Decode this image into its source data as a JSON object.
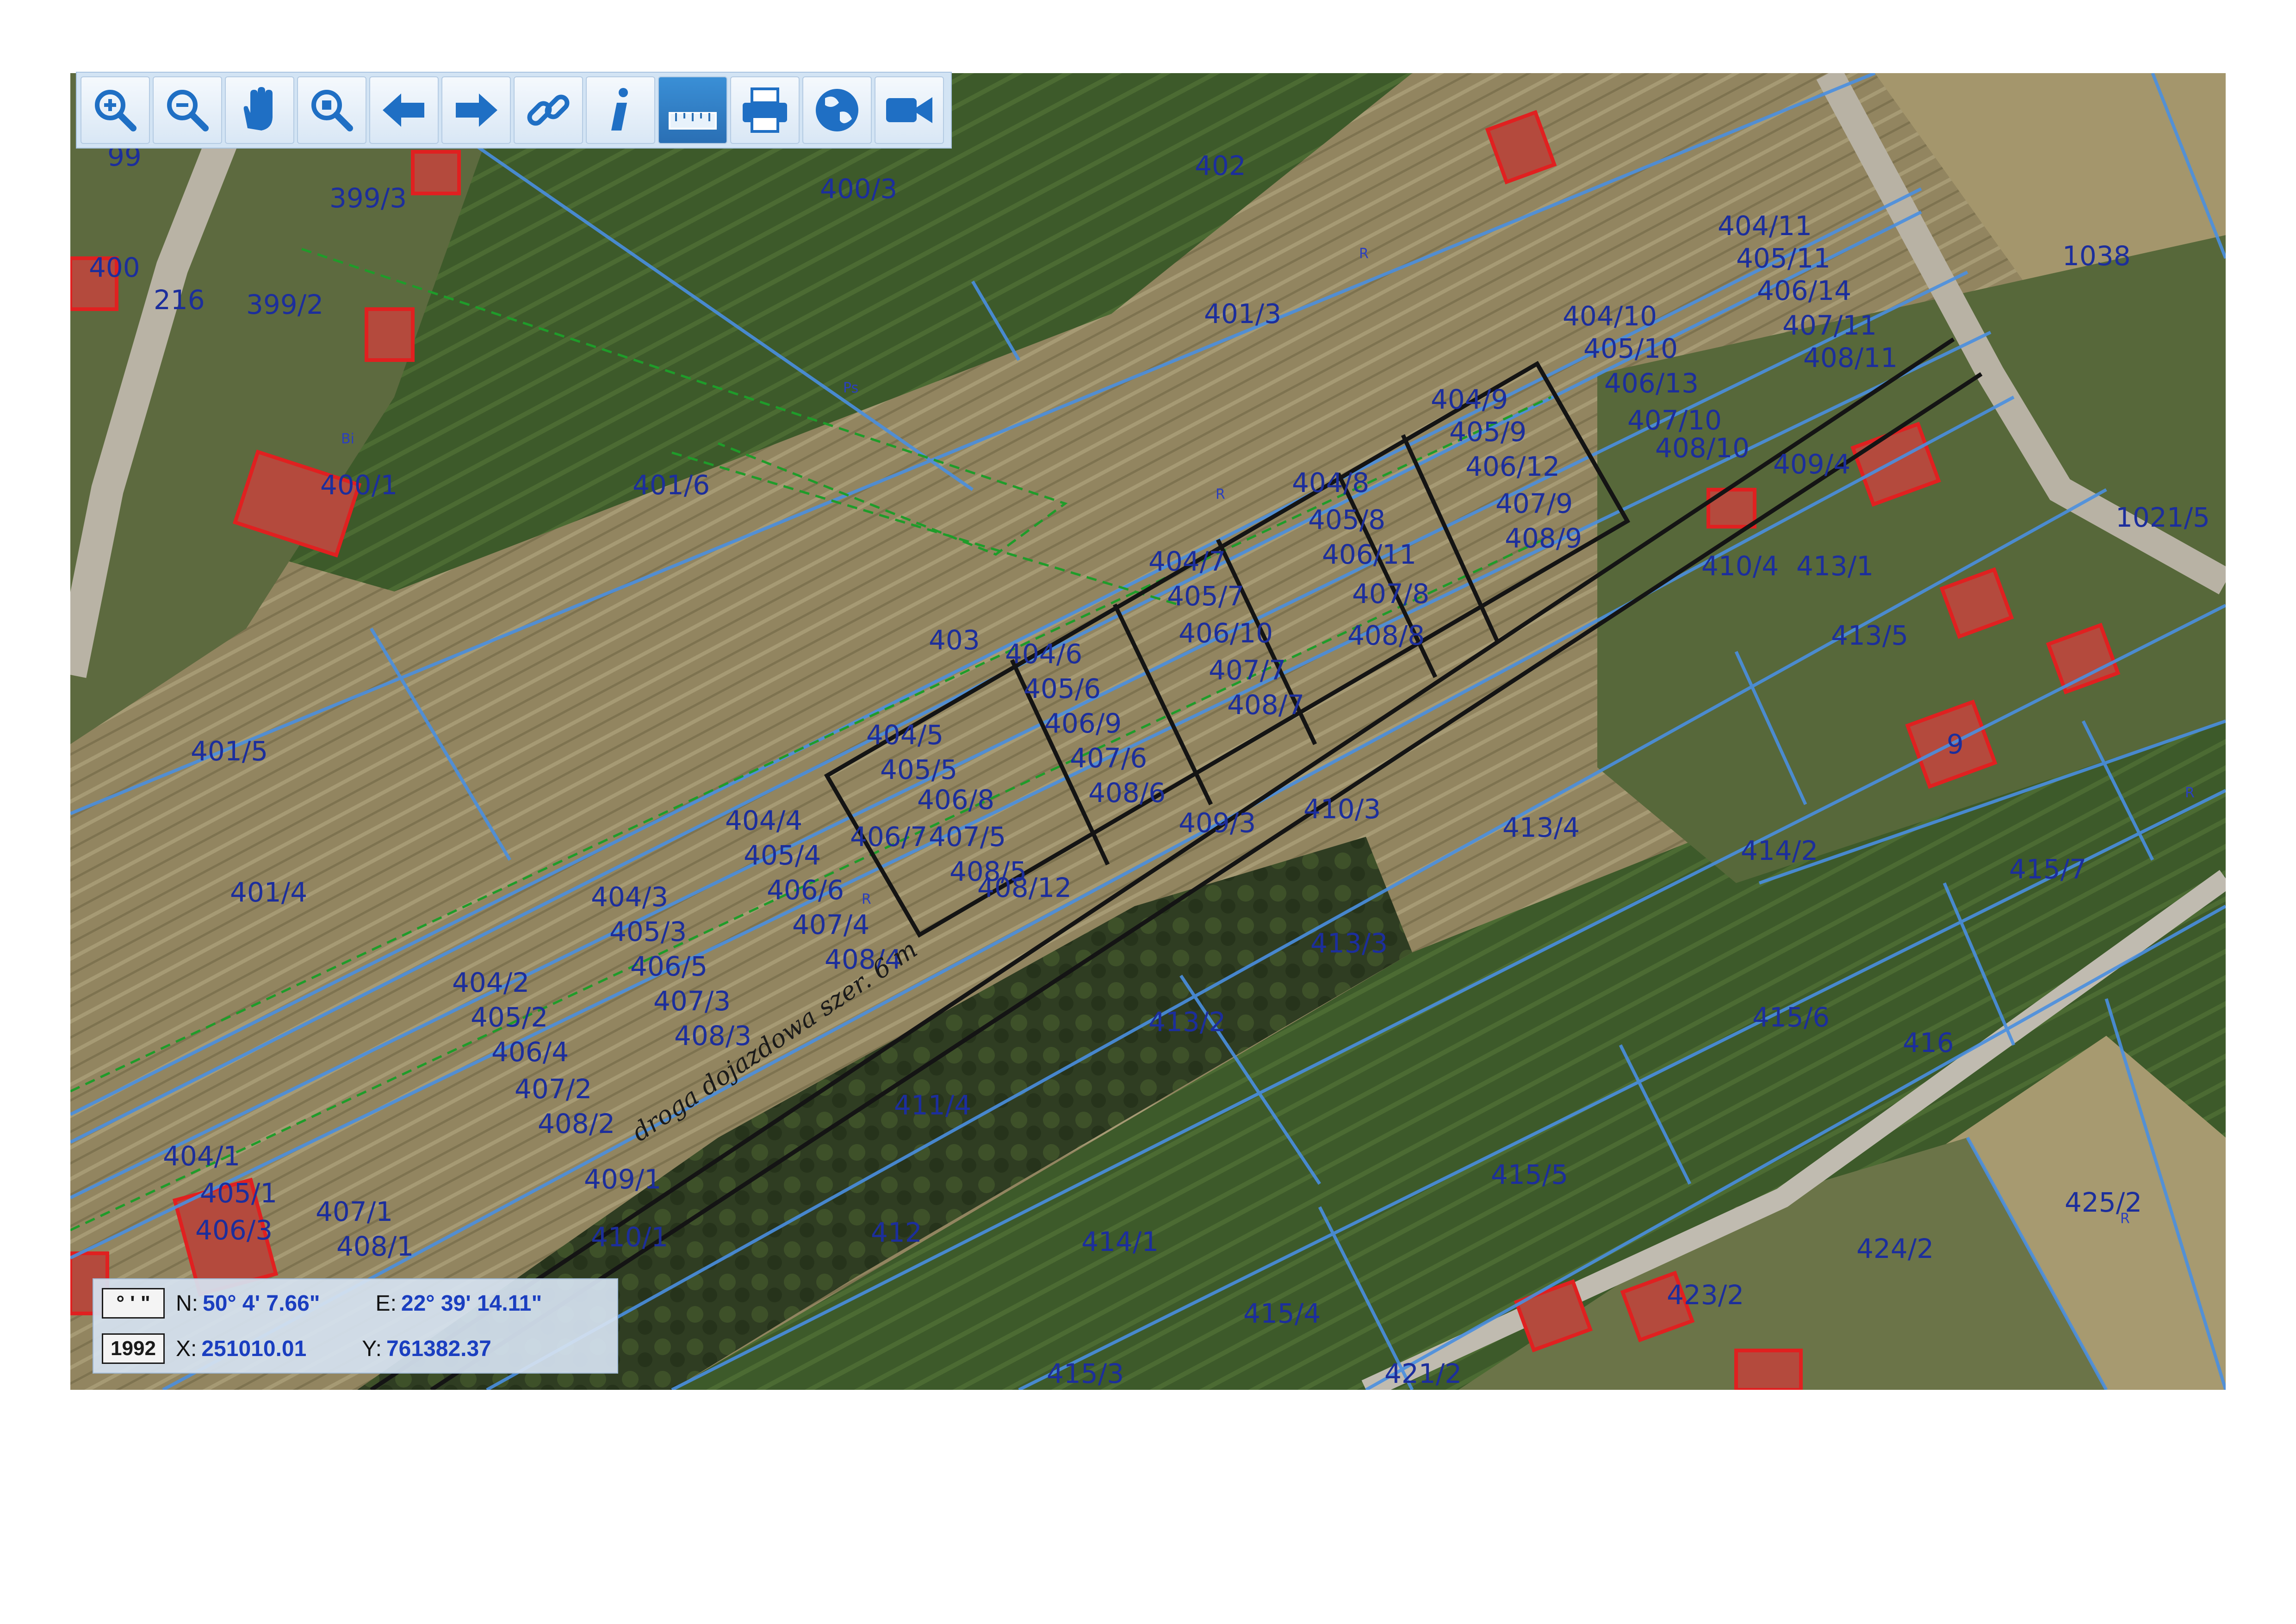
{
  "toolbar": {
    "tools": [
      {
        "name": "zoom-in-icon",
        "active": false
      },
      {
        "name": "zoom-out-icon",
        "active": false
      },
      {
        "name": "pan-hand-icon",
        "active": false
      },
      {
        "name": "zoom-extent-icon",
        "active": false
      },
      {
        "name": "back-arrow-icon",
        "active": false
      },
      {
        "name": "forward-arrow-icon",
        "active": false
      },
      {
        "name": "link-icon",
        "active": false
      },
      {
        "name": "info-icon",
        "active": true
      },
      {
        "name": "measure-ruler-icon",
        "active": true
      },
      {
        "name": "print-icon",
        "active": false
      },
      {
        "name": "globe-icon",
        "active": false
      },
      {
        "name": "video-camera-icon",
        "active": false
      }
    ],
    "info_glyph": "i"
  },
  "coordinates": {
    "dms_icon": "° ' \"",
    "system_icon": "1992",
    "n_key": "N:",
    "n_value": "50° 4' 7.66\"",
    "e_key": "E:",
    "e_value": "22° 39' 14.11\"",
    "x_key": "X:",
    "x_value": "251010.01",
    "y_key": "Y:",
    "y_value": "761382.37"
  },
  "map": {
    "road_label": "droga dojazdowa szer. 6 m",
    "parcels": [
      "400/3",
      "402",
      "401/3",
      "399/3",
      "399/2",
      "216",
      "400",
      "99",
      "400/1",
      "401/6",
      "401/5",
      "401/4",
      "403",
      "404/11",
      "405/11",
      "406/14",
      "407/11",
      "408/11",
      "1038",
      "404/10",
      "405/10",
      "406/13",
      "407/10",
      "408/10",
      "404/9",
      "405/9",
      "406/12",
      "407/9",
      "408/9",
      "409/4",
      "404/8",
      "405/8",
      "406/11",
      "407/8",
      "408/8",
      "404/7",
      "405/7",
      "406/10",
      "407/7",
      "408/7",
      "404/6",
      "405/6",
      "406/9",
      "407/6",
      "408/6",
      "404/5",
      "405/5",
      "406/8",
      "407/5",
      "408/5",
      "406/7",
      "408/12",
      "404/4",
      "405/4",
      "406/6",
      "407/4",
      "408/4",
      "404/3",
      "405/3",
      "406/5",
      "407/3",
      "408/3",
      "404/2",
      "405/2",
      "406/4",
      "407/2",
      "408/2",
      "404/1",
      "405/1",
      "406/3",
      "407/1",
      "408/1",
      "409/1",
      "410/1",
      "411/4",
      "412",
      "409/3",
      "410/3",
      "413/4",
      "413/3",
      "413/2",
      "414/1",
      "414/2",
      "415/7",
      "415/6",
      "415/5",
      "415/4",
      "415/3",
      "416",
      "421/2",
      "423/2",
      "424/2",
      "425/2",
      "410/4",
      "413/1",
      "413/5",
      "1021/5",
      "9"
    ],
    "land_use_codes": [
      "R",
      "Ps",
      "Bi",
      "R",
      "R",
      "R",
      "R"
    ]
  }
}
